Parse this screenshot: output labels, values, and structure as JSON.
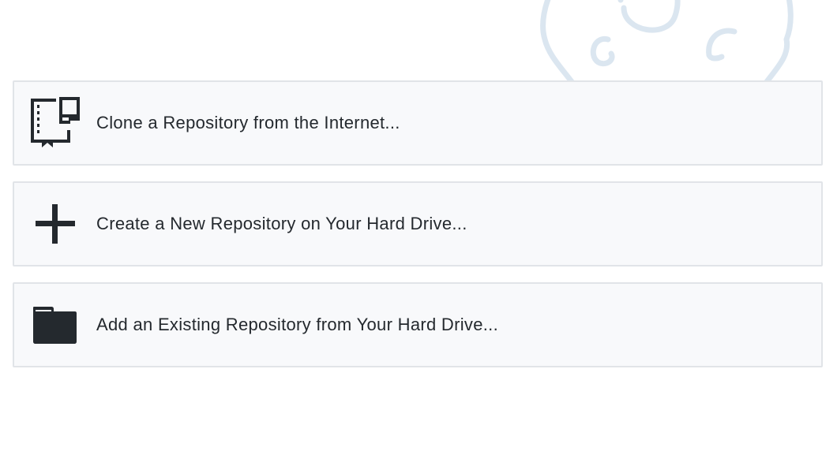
{
  "colors": {
    "option_background": "#f8f9fb",
    "option_border": "#e1e4e8",
    "text": "#24292e",
    "icon": "#24292e",
    "mascot_outline": "#dbe6f0"
  },
  "options": [
    {
      "icon": "repo-clone-icon",
      "label": "Clone a Repository from the Internet..."
    },
    {
      "icon": "plus-icon",
      "label": "Create a New Repository on Your Hard Drive..."
    },
    {
      "icon": "folder-icon",
      "label": "Add an Existing Repository from Your Hard Drive..."
    }
  ]
}
